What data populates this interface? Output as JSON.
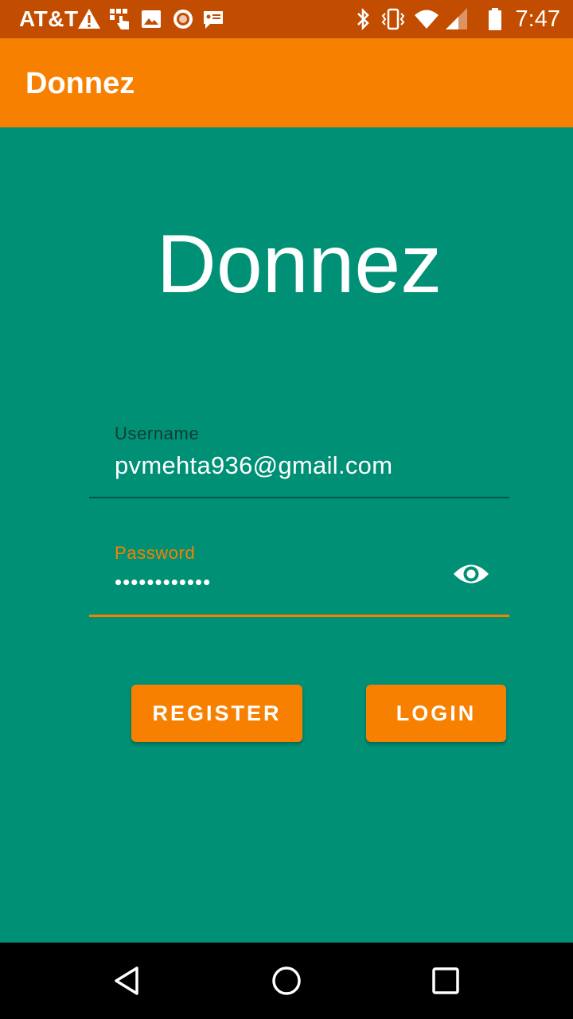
{
  "status_bar": {
    "carrier": "AT&T",
    "time": "7:47",
    "icons": [
      "warning-icon",
      "touch-icon",
      "image-icon",
      "record-icon",
      "chat-icon",
      "bluetooth-icon",
      "vibrate-icon",
      "wifi-icon",
      "signal-icon",
      "battery-icon"
    ]
  },
  "app_bar": {
    "title": "Donnez"
  },
  "main": {
    "logo_text": "Donnez",
    "username": {
      "label": "Username",
      "value": "pvmehta936@gmail.com"
    },
    "password": {
      "label": "Password",
      "value": "••••••••••••",
      "toggle_icon": "eye-icon"
    },
    "register_label": "REGISTER",
    "login_label": "LOGIN"
  },
  "nav_bar": {
    "icons": [
      "back-icon",
      "home-icon",
      "recents-icon"
    ]
  },
  "colors": {
    "status_bar": "#c24d00",
    "app_bar": "#f78000",
    "background": "#009075",
    "accent": "#f78000",
    "text": "#ffffff"
  }
}
